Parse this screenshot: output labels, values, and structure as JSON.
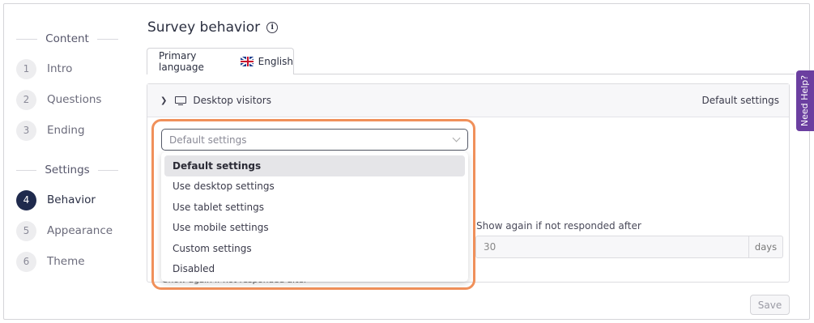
{
  "sidebar": {
    "content_section": "Content",
    "settings_section": "Settings",
    "items": [
      {
        "num": "1",
        "label": "Intro"
      },
      {
        "num": "2",
        "label": "Questions"
      },
      {
        "num": "3",
        "label": "Ending"
      },
      {
        "num": "4",
        "label": "Behavior"
      },
      {
        "num": "5",
        "label": "Appearance"
      },
      {
        "num": "6",
        "label": "Theme"
      }
    ]
  },
  "header": {
    "title": "Survey behavior",
    "info_icon": "info-icon"
  },
  "language_tab": {
    "label": "Primary language",
    "flag": "uk-flag-icon",
    "language": "English"
  },
  "panel": {
    "title": "Desktop visitors",
    "icon": "desktop-icon",
    "status": "Default settings"
  },
  "dropdown": {
    "selected_value": "Default settings",
    "options": [
      "Default settings",
      "Use desktop settings",
      "Use tablet settings",
      "Use mobile settings",
      "Custom settings",
      "Disabled"
    ],
    "highlight_color": "#f0905a"
  },
  "show_again": {
    "label": "Show again if not responded after",
    "value": "30",
    "unit": "days"
  },
  "obscured_text": "Show again if not responded after",
  "footer": {
    "save_label": "Save"
  },
  "need_help": {
    "label": "Need Help?",
    "color": "#6b3fa0"
  },
  "colors": {
    "active_step": "#1f2a4d"
  }
}
